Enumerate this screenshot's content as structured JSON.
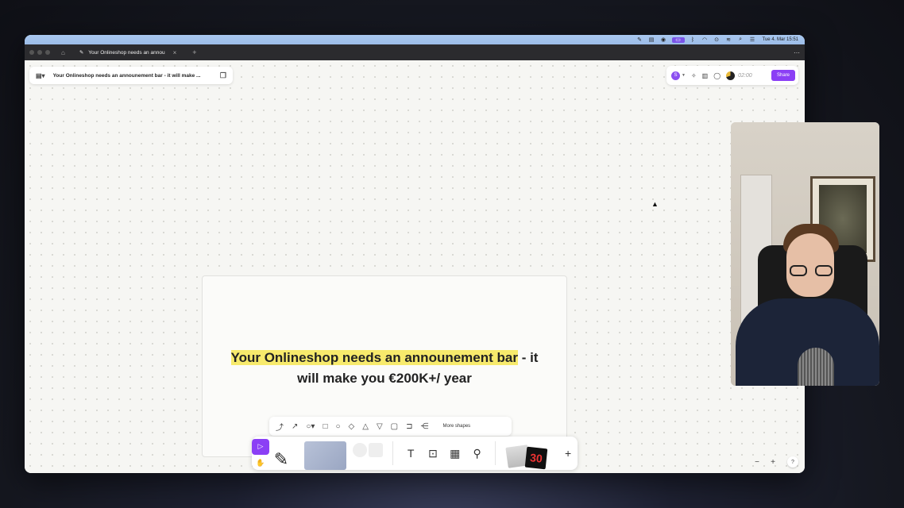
{
  "menubar": {
    "clock": "Tue 4. Mar  15:51"
  },
  "tabbar": {
    "tab_title": "Your Onlineshop needs an annou",
    "add": "+",
    "more": "⋯"
  },
  "board": {
    "title": "Your Onlineshop needs an announement bar - it will make ..."
  },
  "topright": {
    "avatar": "S",
    "timer": "02:00",
    "share_label": "Share"
  },
  "frame": {
    "highlight_text": "Your Onlineshop needs an announement bar",
    "rest_line1": " - it",
    "line2": "will make you €200K+/ year"
  },
  "shapes_bar": {
    "more_label": "More shapes"
  },
  "toolbar": {
    "text_tool": "T",
    "sticker_number": "30",
    "plus": "+"
  },
  "zoom": {
    "minus": "−",
    "plus": "+",
    "help": "?"
  }
}
